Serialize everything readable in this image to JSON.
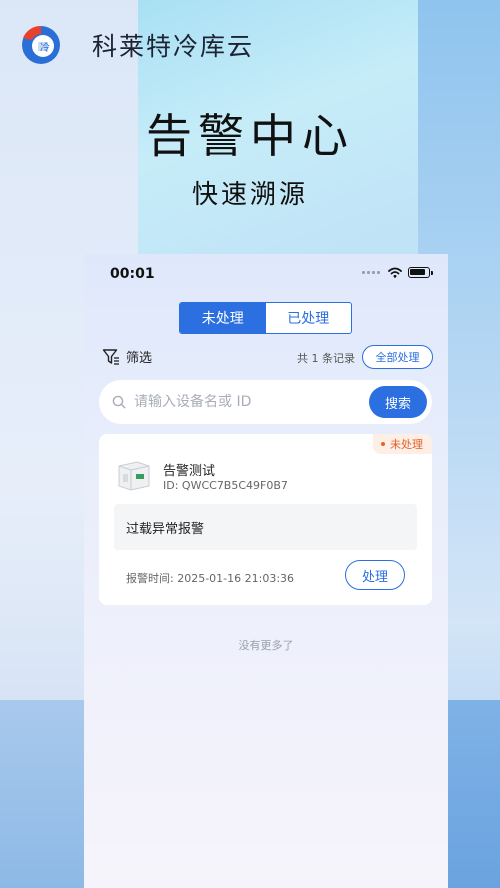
{
  "brand": {
    "name": "科莱特冷库云"
  },
  "hero": {
    "title": "告警中心",
    "subtitle": "快速溯源"
  },
  "status_bar": {
    "time": "00:01"
  },
  "tabs": [
    {
      "label": "未处理",
      "active": true
    },
    {
      "label": "已处理",
      "active": false
    }
  ],
  "toolbar": {
    "filter_label": "筛选",
    "record_count": "共 1 条记录",
    "process_all_label": "全部处理"
  },
  "search": {
    "placeholder": "请输入设备名或 ID",
    "button_label": "搜索"
  },
  "alerts": [
    {
      "status": "未处理",
      "device_name": "告警测试",
      "device_id": "ID: QWCC7B5C49F0B7",
      "message": "过载异常报警",
      "time": "报警时间: 2025-01-16 21:03:36",
      "action_label": "处理"
    }
  ],
  "footer": {
    "no_more": "没有更多了"
  },
  "colors": {
    "accent": "#2b6fe0",
    "warning": "#e2622a",
    "badge_bg": "#fdeee6"
  },
  "icons": [
    "app-logo-icon",
    "wifi-icon",
    "battery-icon",
    "filter-icon",
    "search-icon"
  ]
}
